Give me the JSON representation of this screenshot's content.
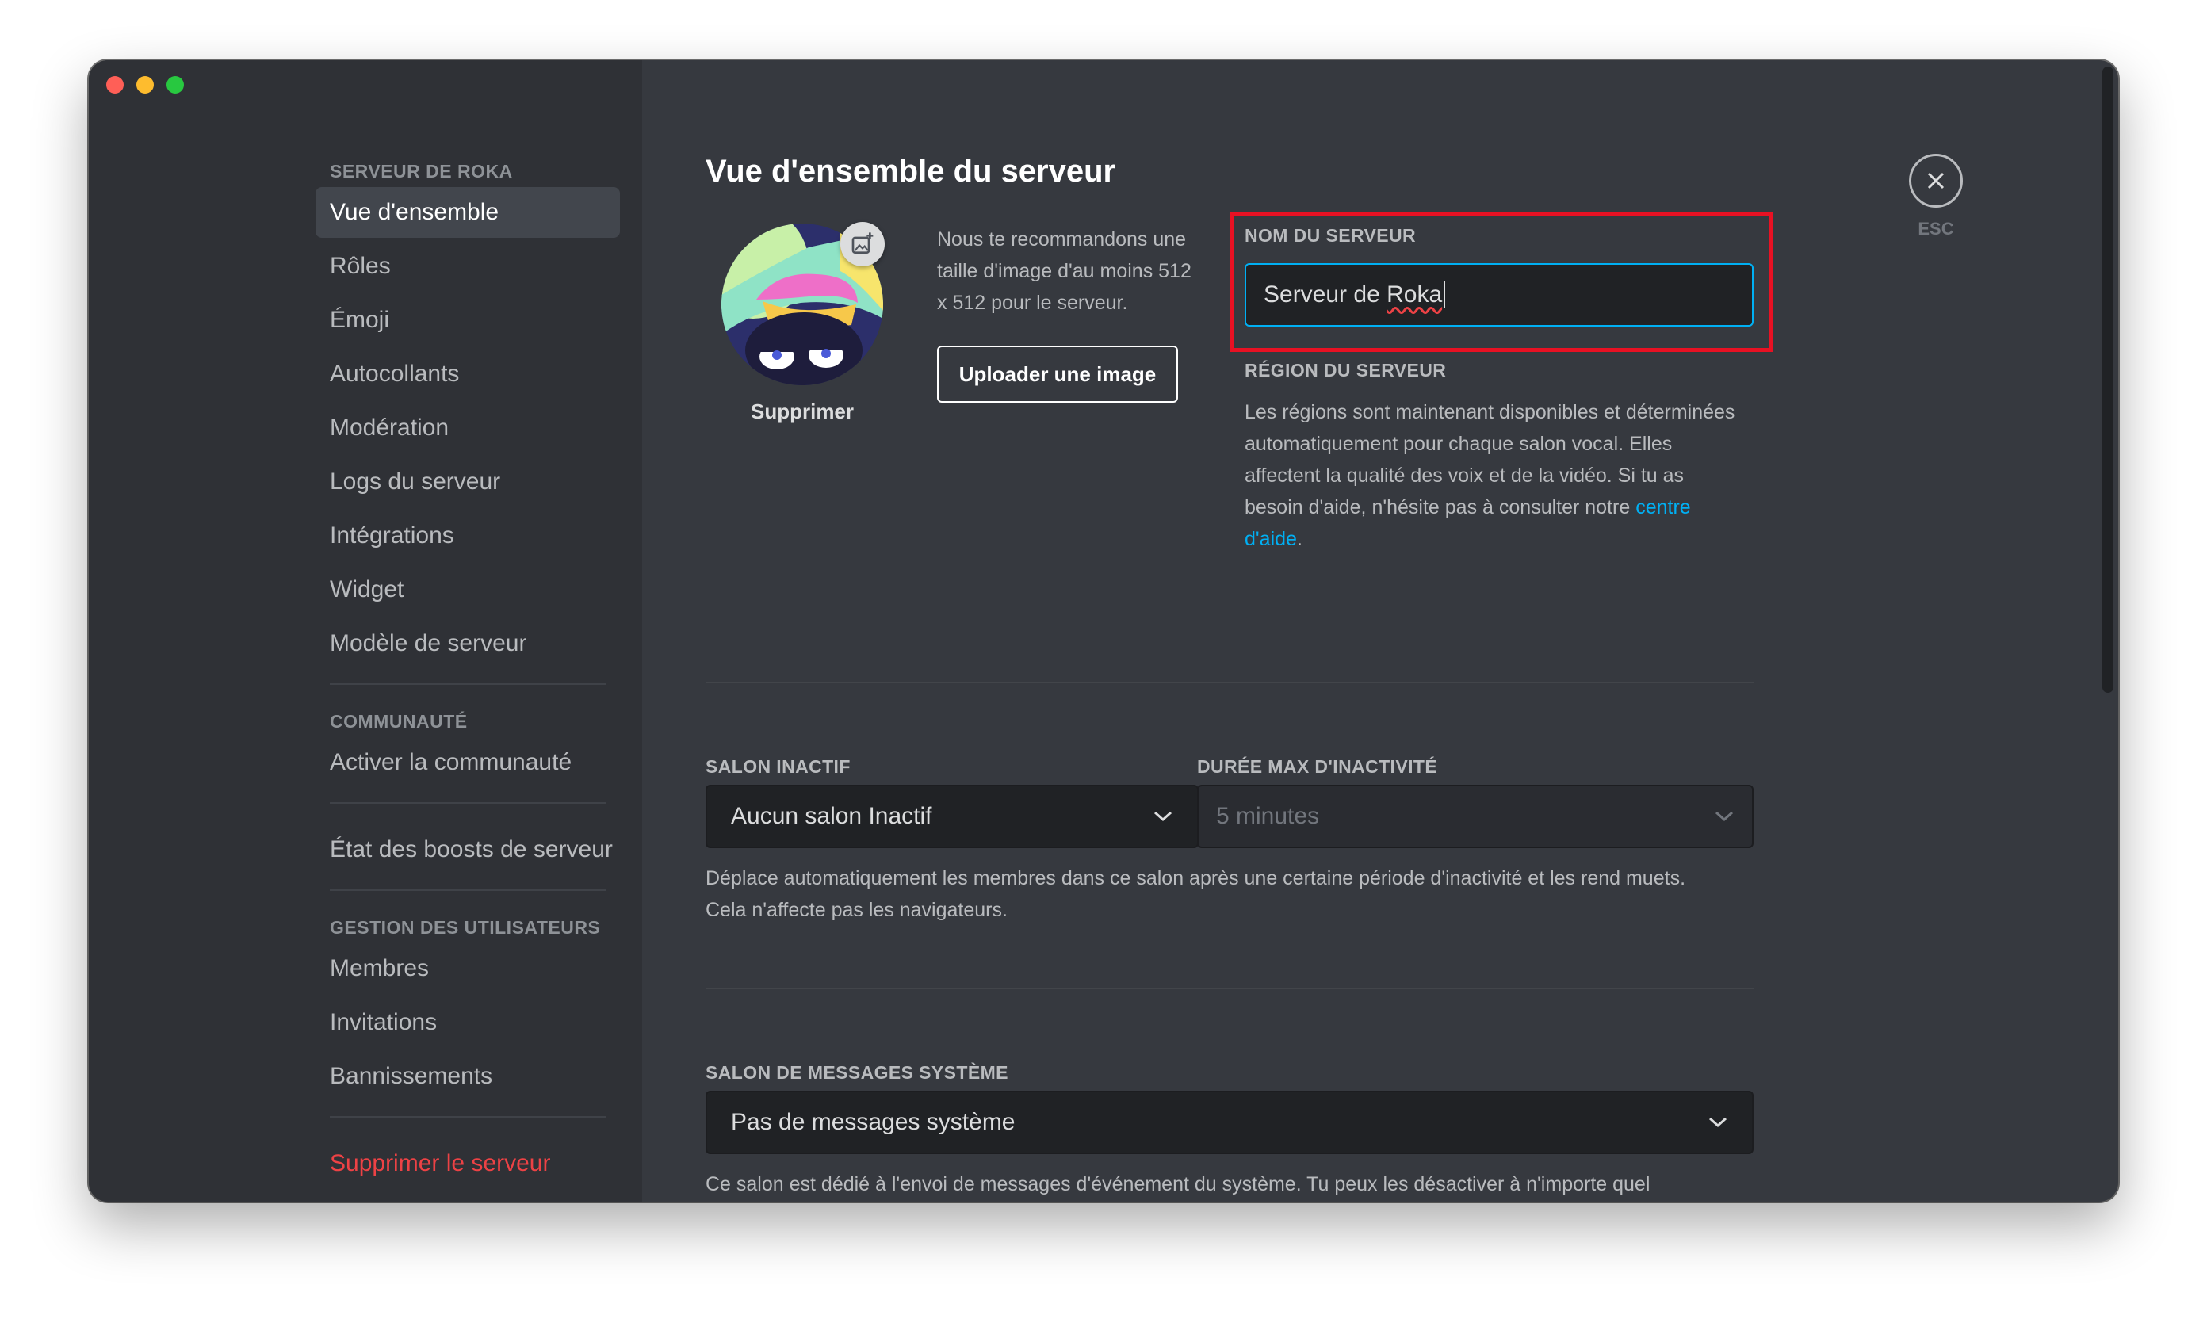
{
  "window": {
    "traffic_lights": [
      "close",
      "minimize",
      "zoom"
    ]
  },
  "sidebar": {
    "server_section": "SERVEUR DE ROKA",
    "items": [
      {
        "label": "Vue d'ensemble"
      },
      {
        "label": "Rôles"
      },
      {
        "label": "Émoji"
      },
      {
        "label": "Autocollants"
      },
      {
        "label": "Modération"
      },
      {
        "label": "Logs du serveur"
      },
      {
        "label": "Intégrations"
      },
      {
        "label": "Widget"
      },
      {
        "label": "Modèle de serveur"
      }
    ],
    "community_section": "COMMUNAUTÉ",
    "community_items": [
      {
        "label": "Activer la communauté"
      }
    ],
    "boost_item": "État des boosts de serveur",
    "users_section": "GESTION DES UTILISATEURS",
    "users_items": [
      {
        "label": "Membres"
      },
      {
        "label": "Invitations"
      },
      {
        "label": "Bannissements"
      }
    ],
    "delete_server": "Supprimer le serveur"
  },
  "main": {
    "title": "Vue d'ensemble du serveur",
    "avatar": {
      "remove_label": "Supprimer",
      "edit_icon": "image-add-icon"
    },
    "recommend_text": "Nous te recommandons une taille d'image d'au moins 512 x 512 pour le serveur.",
    "upload_button": "Uploader une image",
    "server_name": {
      "label": "NOM DU SERVEUR",
      "value_prefix": "Serveur de ",
      "value_misspelled": "Roka"
    },
    "region": {
      "label": "RÉGION DU SERVEUR",
      "text": "Les régions sont maintenant disponibles et déterminées automatiquement pour chaque salon vocal. Elles affectent la qualité des voix et de la vidéo. Si tu as besoin d'aide, n'hésite pas à consulter notre ",
      "link": "centre d'aide",
      "suffix": "."
    },
    "inactive_channel": {
      "label": "SALON INACTIF",
      "value": "Aucun salon Inactif"
    },
    "inactive_timeout": {
      "label": "DURÉE MAX D'INACTIVITÉ",
      "value": "5 minutes",
      "disabled": true
    },
    "inactive_help_1": "Déplace automatiquement les membres dans ce salon après une certaine période d'inactivité et les rend muets.",
    "inactive_help_2": "Cela n'affecte pas les navigateurs.",
    "system_channel": {
      "label": "SALON DE MESSAGES SYSTÈME",
      "value": "Pas de messages système"
    },
    "system_help": "Ce salon est dédié à l'envoi de messages d'événement du système. Tu peux les désactiver à n'importe quel"
  },
  "close": {
    "label": "ESC",
    "icon": "close-icon"
  },
  "colors": {
    "sidebar_bg": "#2f3136",
    "main_bg": "#36393f",
    "input_bg": "#202225",
    "accent_blue": "#00b0f4",
    "danger": "#ed4245",
    "highlight_box": "#e81123"
  }
}
